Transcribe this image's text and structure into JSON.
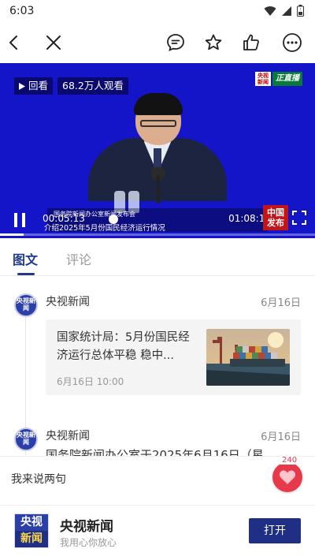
{
  "status_bar": {
    "time": "6:03",
    "icons": [
      "wifi-icon",
      "signal-icon",
      "battery-icon"
    ]
  },
  "nav": {
    "icons": [
      "back-arrow-icon",
      "close-icon",
      "comment-bubble-icon",
      "star-icon",
      "thumbs-up-icon",
      "more-icon"
    ]
  },
  "video": {
    "replay_label": "回看",
    "viewers": "68.2万人观看",
    "live_logo_small": "央视新闻",
    "live_label": "正直播",
    "caption_line1": "国务院新闻办公室新闻发布会",
    "caption_line2": "介绍2025年5月份国民经济运行情况",
    "current_time": "00:05:13",
    "duration": "01:08:10",
    "progress_fraction": 0.075,
    "channel_logo": "中国发布",
    "accent_color": "#1414c8"
  },
  "tabs": [
    {
      "label": "图文",
      "active": true
    },
    {
      "label": "评论",
      "active": false
    }
  ],
  "feed": [
    {
      "avatar_text": "央视新闻",
      "author": "央视新闻",
      "date": "6月16日",
      "card": {
        "title": "国家统计局：5月份国民经济运行总体平稳 稳中...",
        "date": "6月16日 10:00",
        "thumb": "container-port-image"
      }
    },
    {
      "avatar_text": "央视新闻",
      "author": "央视新闻",
      "date": "6月16日",
      "preview_text": "国务院新闻办公室于2025年6月16日（星"
    }
  ],
  "comment_bar": {
    "placeholder": "我来说两句",
    "like_count": "240"
  },
  "app_banner": {
    "logo_top": "央视",
    "logo_bottom": "新闻",
    "name": "央视新闻",
    "slogan": "我用心你放心",
    "open_label": "打开"
  }
}
